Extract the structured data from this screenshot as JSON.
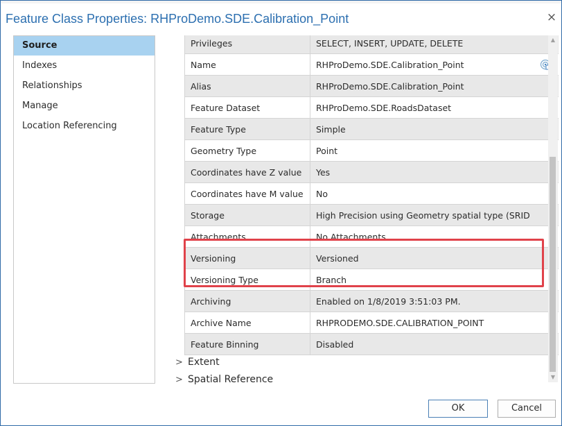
{
  "window": {
    "title": "Feature Class Properties: RHProDemo.SDE.Calibration_Point",
    "close_glyph": "×"
  },
  "sidebar": {
    "selected_index": 0,
    "items": [
      {
        "label": "Source"
      },
      {
        "label": "Indexes"
      },
      {
        "label": "Relationships"
      },
      {
        "label": "Manage"
      },
      {
        "label": "Location Referencing"
      }
    ]
  },
  "properties": {
    "rows": [
      {
        "name": "Privileges",
        "value": "SELECT, INSERT, UPDATE, DELETE"
      },
      {
        "name": "Name",
        "value": "RHProDemo.SDE.Calibration_Point",
        "icon": "spatial-reference-icon"
      },
      {
        "name": "Alias",
        "value": "RHProDemo.SDE.Calibration_Point"
      },
      {
        "name": "Feature Dataset",
        "value": "RHProDemo.SDE.RoadsDataset"
      },
      {
        "name": "Feature Type",
        "value": "Simple"
      },
      {
        "name": "Geometry Type",
        "value": "Point"
      },
      {
        "name": "Coordinates have Z value",
        "value": "Yes"
      },
      {
        "name": "Coordinates have M value",
        "value": "No"
      },
      {
        "name": "Storage",
        "value": "High Precision using Geometry spatial type (SRID"
      },
      {
        "name": "Attachments",
        "value": "No Attachments"
      },
      {
        "name": "Versioning",
        "value": "Versioned"
      },
      {
        "name": "Versioning Type",
        "value": "Branch"
      },
      {
        "name": "Archiving",
        "value": "Enabled on 1/8/2019 3:51:03 PM."
      },
      {
        "name": "Archive Name",
        "value": "RHPRODEMO.SDE.CALIBRATION_POINT"
      },
      {
        "name": "Feature Binning",
        "value": "Disabled"
      }
    ],
    "highlight_color": "#e0424a"
  },
  "sections": [
    {
      "label": "Extent",
      "expander": ">"
    },
    {
      "label": "Spatial Reference",
      "expander": ">"
    }
  ],
  "scrollbar": {
    "up_glyph": "▲",
    "down_glyph": "▼"
  },
  "buttons": {
    "ok_label": "OK",
    "cancel_label": "Cancel"
  },
  "colors": {
    "title": "#2c6fb0",
    "selected_nav": "#a8d2f0",
    "row_shade": "#e8e8e8"
  }
}
